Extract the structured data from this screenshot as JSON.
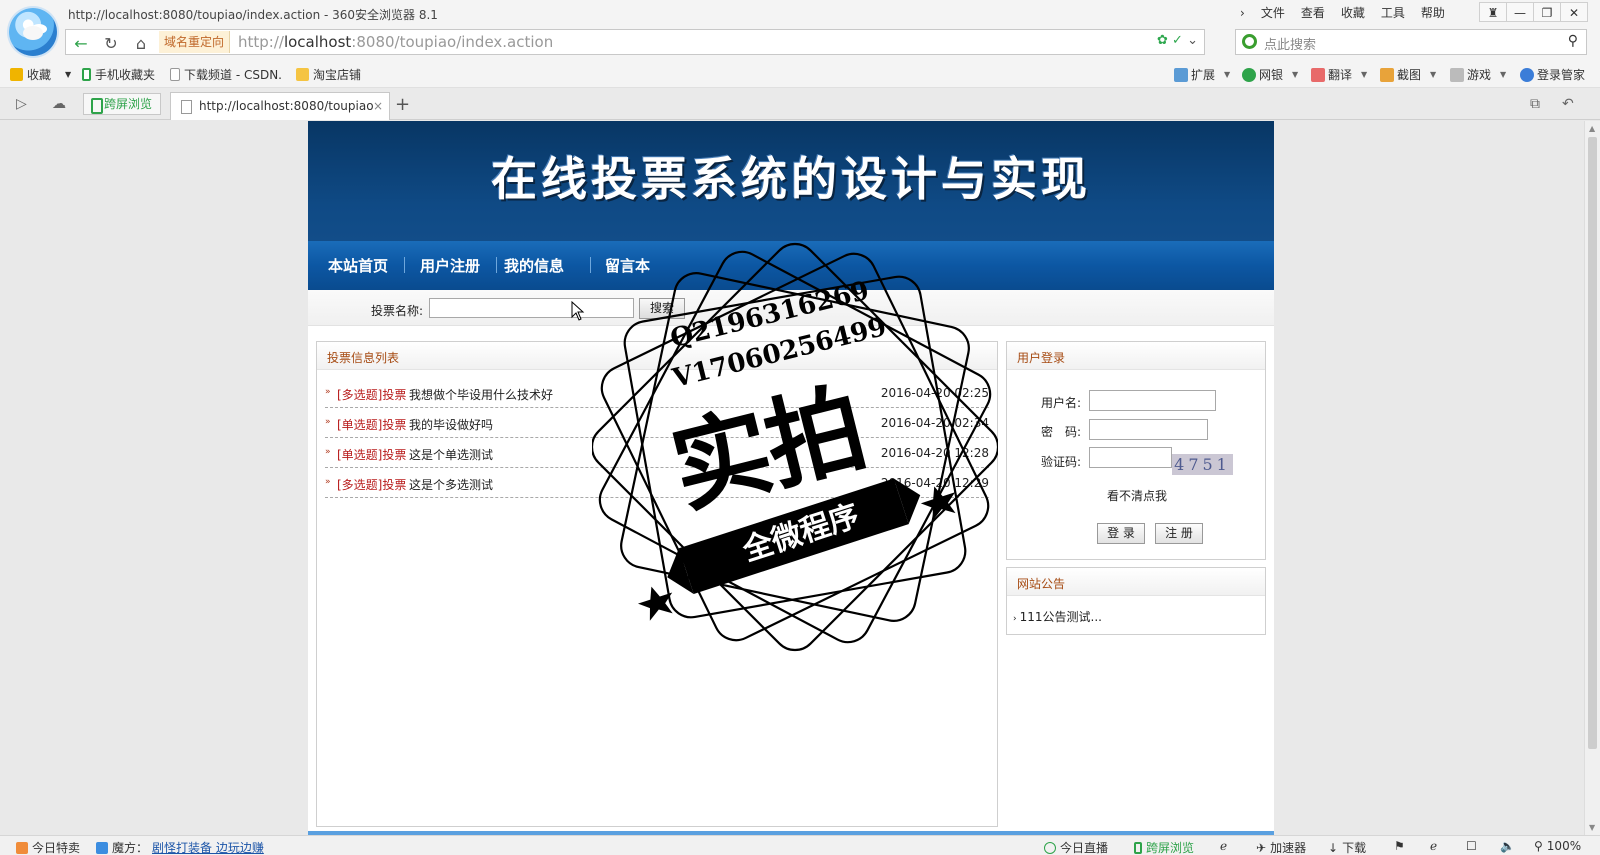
{
  "browser": {
    "window_title": "http://localhost:8080/toupiao/index.action - 360安全浏览器 8.1",
    "menu": [
      "文件",
      "查看",
      "收藏",
      "工具",
      "帮助"
    ],
    "redirect_label": "域名重定向",
    "url_prefix": "http://",
    "url_host": "localhost",
    "url_rest": ":8080/toupiao/index.action",
    "search_placeholder": "点此搜索",
    "bookmarks": [
      "收藏",
      "手机收藏夹",
      "下载频道 - CSDN.",
      "淘宝店铺"
    ],
    "extensions": [
      "扩展",
      "网银",
      "翻译",
      "截图",
      "游戏",
      "登录管家"
    ],
    "split_tab_label": "跨屏浏览",
    "tab_title": "http://localhost:8080/toupiao",
    "status": {
      "left1": "今日特卖",
      "left2": "魔方：",
      "left_link": "剧怪打装备 边玩边赚",
      "right": [
        "今日直播",
        "跨屏浏览",
        "加速器",
        "下载",
        "100%"
      ]
    },
    "colors": {
      "accent_green": "#2ea34a",
      "link_blue": "#1c55a8"
    }
  },
  "site": {
    "banner_title": "在线投票系统的设计与实现",
    "nav": [
      "本站首页",
      "用户注册",
      "我的信息",
      "留言本"
    ],
    "search": {
      "label": "投票名称:",
      "button": "搜索",
      "value": ""
    },
    "vote_panel_title": "投票信息列表",
    "votes": [
      {
        "type": "[多选题]投票",
        "name": "我想做个毕设用什么技术好",
        "date": "2016-04-20 02:25"
      },
      {
        "type": "[单选题]投票",
        "name": "我的毕设做好吗",
        "date": "2016-04-20 02:34"
      },
      {
        "type": "[单选题]投票",
        "name": "这是个单选测试",
        "date": "2016-04-20 12:28"
      },
      {
        "type": "[多选题]投票",
        "name": "这是个多选测试",
        "date": "2016-04-20 12:29"
      }
    ],
    "login": {
      "title": "用户登录",
      "username_label": "用户名:",
      "password_label": "密　码:",
      "captcha_label": "验证码:",
      "captcha_value": "4751",
      "refresh_text": "看不清点我",
      "login_button": "登 录",
      "register_button": "注 册"
    },
    "notice": {
      "title": "网站公告",
      "items": [
        "111公告测试..."
      ]
    },
    "colors": {
      "banner": "#0f4a85",
      "nav": "#0c57a3",
      "panel_title": "#a64b13",
      "vote_type": "#b81c1c"
    }
  },
  "watermark": {
    "line1": "Q2196316269",
    "line2": "V17060256499",
    "main": "实拍",
    "ribbon": "全微程序"
  }
}
